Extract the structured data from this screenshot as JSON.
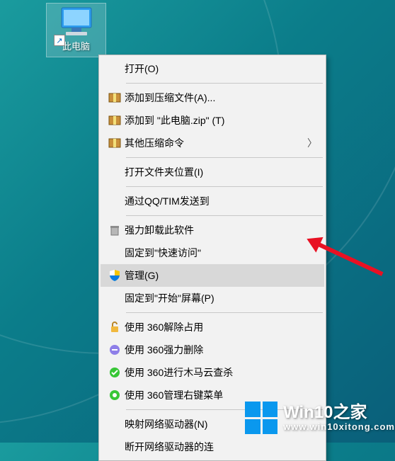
{
  "desktop_icon": {
    "label": "此电脑"
  },
  "menu": {
    "open": "打开(O)",
    "add_archive": "添加到压缩文件(A)...",
    "add_zip": "添加到 \"此电脑.zip\" (T)",
    "other_compress": "其他压缩命令",
    "open_location": "打开文件夹位置(I)",
    "qq_send": "通过QQ/TIM发送到",
    "force_uninstall": "强力卸载此软件",
    "pin_quick": "固定到\"快速访问\"",
    "manage": "管理(G)",
    "pin_start": "固定到\"开始\"屏幕(P)",
    "360_unlock": "使用 360解除占用",
    "360_delete": "使用 360强力删除",
    "360_scan": "使用 360进行木马云查杀",
    "360_menu": "使用 360管理右键菜单",
    "map_drive": "映射网络驱动器(N)",
    "disconnect_drive": "断开网络驱动器的连"
  },
  "watermark": {
    "title": "Win10之家",
    "url": "www.win10xitong.com"
  }
}
